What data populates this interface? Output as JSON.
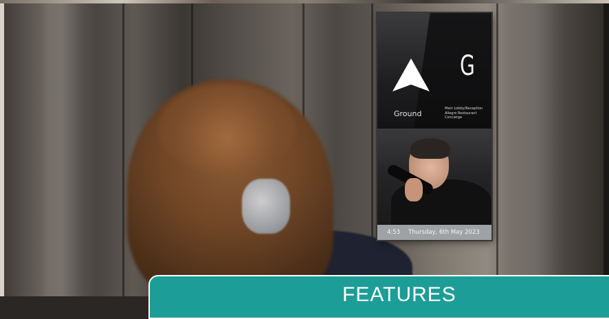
{
  "display": {
    "direction_icon": "up-arrow-icon",
    "floor_letter": "G",
    "floor_name": "Ground",
    "floor_info": [
      "Main Lobby/Reception",
      "Allegro Restaurant",
      "Concierge"
    ],
    "time": "4:53",
    "date": "Thursday, 6th May 2023"
  },
  "banner": {
    "title": "FEATURES"
  },
  "colors": {
    "banner_teal": "#1d9d97",
    "display_dark": "#0d0d0e",
    "footer_grey": "#9fa2a4"
  }
}
